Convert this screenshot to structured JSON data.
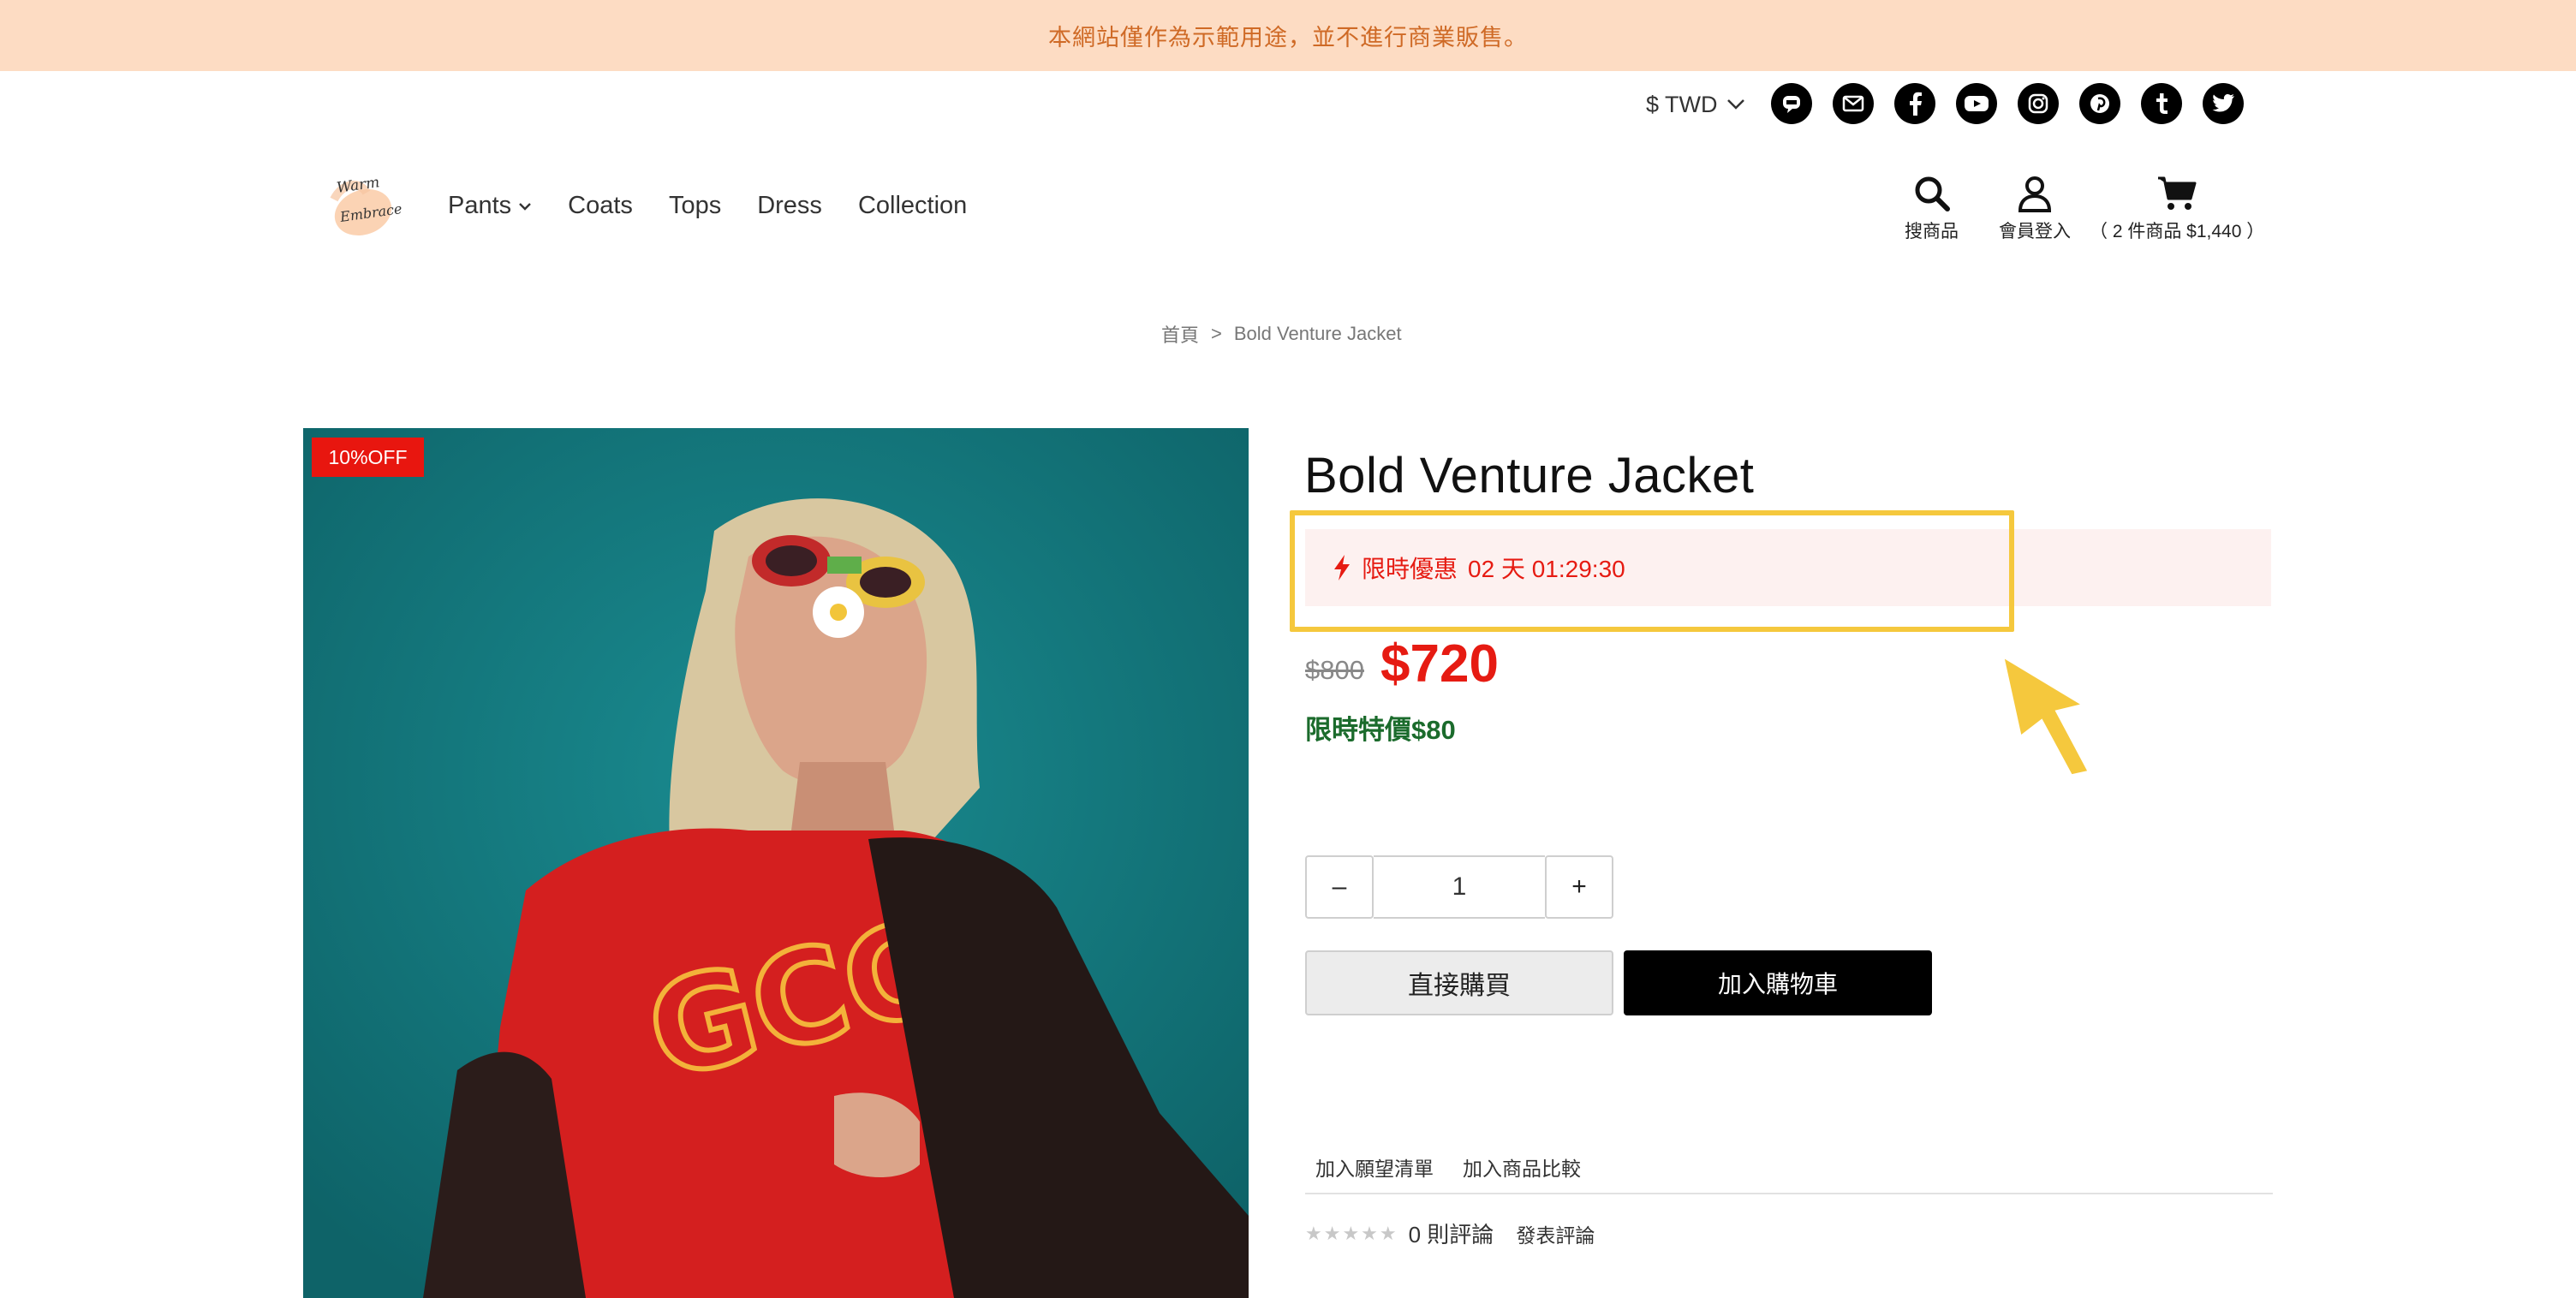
{
  "banner": {
    "text": "本網站僅作為示範用途，並不進行商業販售。"
  },
  "topbar": {
    "currency": "$ TWD",
    "social_icons": [
      "line-icon",
      "email-icon",
      "facebook-icon",
      "youtube-icon",
      "instagram-icon",
      "pinterest-icon",
      "tumblr-icon",
      "twitter-icon"
    ]
  },
  "header": {
    "logo_text": "Warm Embrace",
    "nav": [
      {
        "label": "Pants",
        "has_dropdown": true
      },
      {
        "label": "Coats"
      },
      {
        "label": "Tops"
      },
      {
        "label": "Dress"
      },
      {
        "label": "Collection"
      }
    ],
    "search_label": "搜商品",
    "account_label": "會員登入",
    "cart_label": "（ 2 件商品 $1,440 ）"
  },
  "breadcrumb": {
    "home": "首頁",
    "separator": ">",
    "current": "Bold Venture Jacket"
  },
  "product": {
    "badge": "10%OFF",
    "title": "Bold Venture Jacket",
    "promo_label": "限時優惠",
    "countdown": "02 天 01:29:30",
    "original_price": "$800",
    "sale_price": "$720",
    "special_text": "限時特價$80",
    "quantity": "1",
    "minus_label": "–",
    "plus_label": "+",
    "buy_now": "直接購買",
    "add_to_cart": "加入購物車",
    "wishlist": "加入願望清單",
    "compare": "加入商品比較",
    "stars": "★★★★★",
    "rating_value": 0,
    "review_count": "0 則評論",
    "write_review": "發表評論"
  },
  "colors": {
    "banner_bg": "#fddcc3",
    "banner_text": "#cf6a26",
    "accent_red": "#e61b12",
    "special_green": "#1b6b2c",
    "highlight_yellow": "#f5c83d"
  }
}
